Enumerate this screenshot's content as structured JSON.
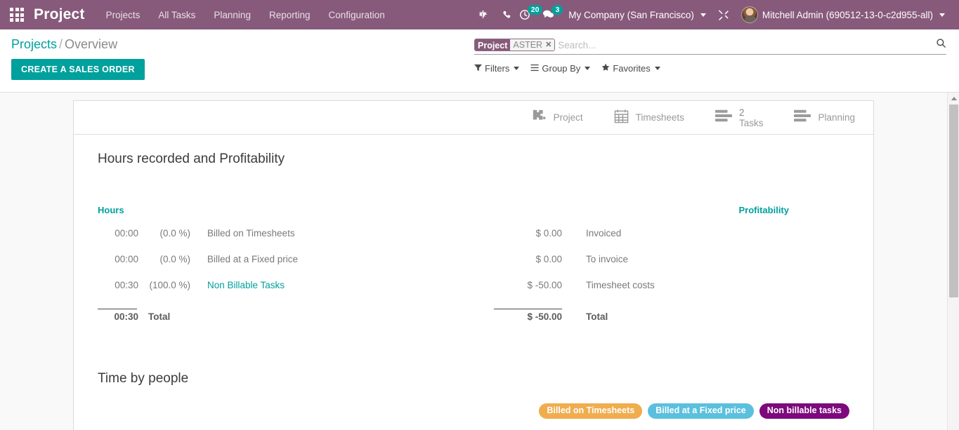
{
  "navbar": {
    "apps_icon": "apps-grid-icon",
    "brand": "Project",
    "menu": [
      {
        "label": "Projects"
      },
      {
        "label": "All Tasks"
      },
      {
        "label": "Planning"
      },
      {
        "label": "Reporting"
      },
      {
        "label": "Configuration"
      }
    ],
    "icons": {
      "bug": "bug-icon",
      "phone": "phone-icon",
      "activities": "clock-icon",
      "messages": "chat-icon"
    },
    "activities_count": "20",
    "messages_count": "3",
    "company": "My Company (San Francisco)",
    "debug_icon": "tools-icon",
    "user": "Mitchell Admin (690512-13-0-c2d955-all)",
    "colors": {
      "bar": "#875A7B",
      "badge": "#00A09D"
    }
  },
  "control_panel": {
    "breadcrumb_root": "Projects",
    "breadcrumb_sep": "/",
    "breadcrumb_current": "Overview",
    "primary_button": "CREATE A SALES ORDER",
    "search": {
      "facet_label": "Project",
      "facet_value": "ASTER",
      "facet_remove": "✕",
      "placeholder": "Search...",
      "value": "",
      "magnifier_icon": "search-icon"
    },
    "dropdowns": [
      {
        "label": "Filters",
        "icon": "filter-icon"
      },
      {
        "label": "Group By",
        "icon": "bars-icon"
      },
      {
        "label": "Favorites",
        "icon": "star-icon"
      }
    ]
  },
  "stat_buttons": [
    {
      "icon": "puzzle-icon",
      "value": "",
      "label": "Project"
    },
    {
      "icon": "calendar-icon",
      "value": "",
      "label": "Timesheets"
    },
    {
      "icon": "list-icon",
      "value": "2",
      "label": "Tasks"
    },
    {
      "icon": "list-icon",
      "value": "",
      "label": "Planning"
    }
  ],
  "dashboard": {
    "title": "Hours recorded and Profitability",
    "hours": {
      "header": "Hours",
      "rows": [
        {
          "hours": "00:00",
          "pct": "(0.0 %)",
          "label": "Billed on Timesheets",
          "is_link": false
        },
        {
          "hours": "00:00",
          "pct": "(0.0 %)",
          "label": "Billed at a Fixed price",
          "is_link": false
        },
        {
          "hours": "00:30",
          "pct": "(100.0 %)",
          "label": "Non Billable Tasks",
          "is_link": true
        }
      ],
      "total_value": "00:30",
      "total_label": "Total"
    },
    "profitability": {
      "header": "Profitability",
      "rows": [
        {
          "amount": "$ 0.00",
          "label": "Invoiced"
        },
        {
          "amount": "$ 0.00",
          "label": "To invoice"
        },
        {
          "amount": "$ -50.00",
          "label": "Timesheet costs"
        }
      ],
      "total_value": "$ -50.00",
      "total_label": "Total"
    },
    "time_by_people_title": "Time by people",
    "legend": [
      {
        "label": "Billed on Timesheets",
        "color": "#F0AD4E"
      },
      {
        "label": "Billed at a Fixed price",
        "color": "#5BC0DE"
      },
      {
        "label": "Non billable tasks",
        "color": "#7D0A7D"
      }
    ]
  }
}
